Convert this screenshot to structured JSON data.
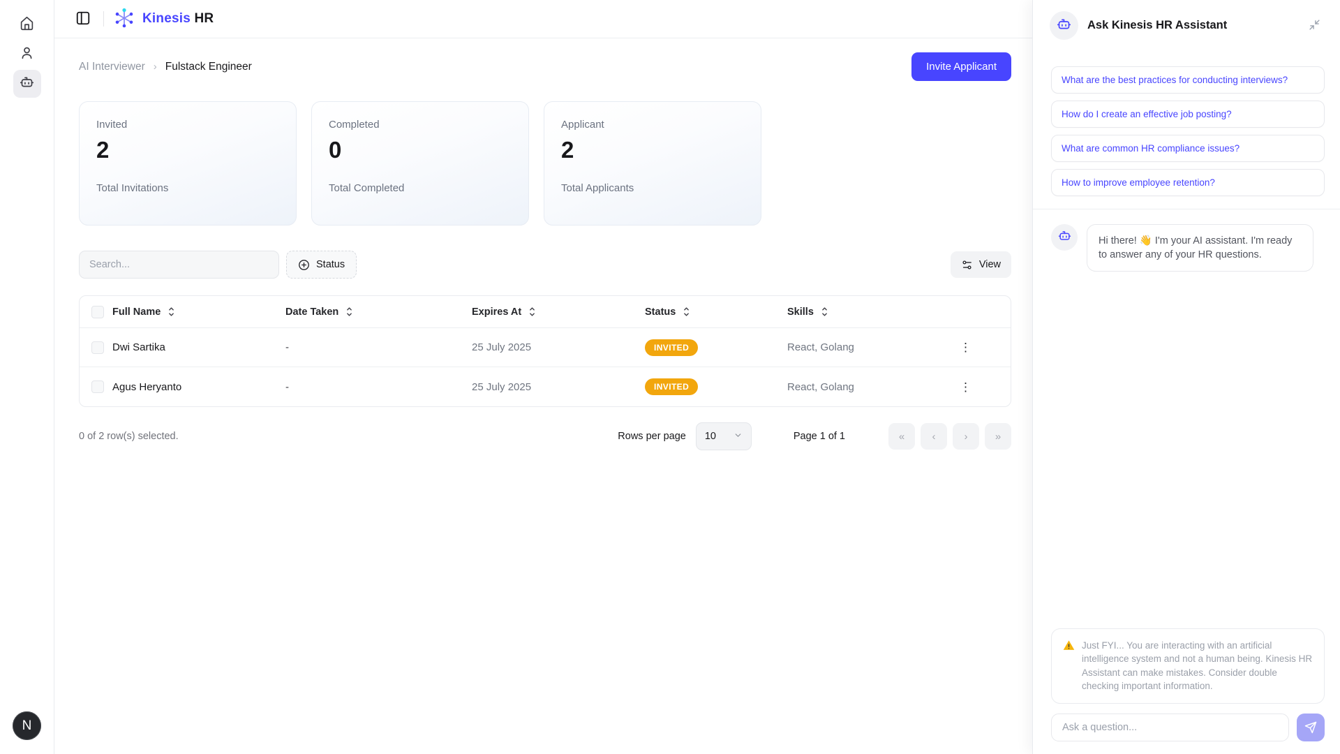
{
  "colors": {
    "brand": "#4845ff",
    "badge": "#f2a60d",
    "logo_accent": "#2bd9ee"
  },
  "sidebar": {
    "items": [
      {
        "name": "home",
        "icon": "home-icon"
      },
      {
        "name": "users",
        "icon": "user-icon"
      },
      {
        "name": "ai-interviewer",
        "icon": "bot-icon",
        "active": true
      }
    ],
    "avatar_label": "N"
  },
  "topbar": {
    "brand_primary": "Kinesis",
    "brand_secondary": "HR"
  },
  "breadcrumb": {
    "parent": "AI Interviewer",
    "separator": "›",
    "current": "Fulstack Engineer"
  },
  "invite_button_label": "Invite Applicant",
  "stats": [
    {
      "label": "Invited",
      "value": "2",
      "sub": "Total Invitations"
    },
    {
      "label": "Completed",
      "value": "0",
      "sub": "Total Completed"
    },
    {
      "label": "Applicant",
      "value": "2",
      "sub": "Total Applicants"
    }
  ],
  "toolbar": {
    "search_placeholder": "Search...",
    "status_label": "Status",
    "view_label": "View"
  },
  "table": {
    "columns": {
      "full_name": "Full Name",
      "date_taken": "Date Taken",
      "expires_at": "Expires At",
      "status": "Status",
      "skills": "Skills"
    },
    "row_menu_glyph": "⋮",
    "rows": [
      {
        "full_name": "Dwi Sartika",
        "date_taken": "-",
        "expires_at": "25 July 2025",
        "status": "INVITED",
        "skills": "React, Golang"
      },
      {
        "full_name": "Agus Heryanto",
        "date_taken": "-",
        "expires_at": "25 July 2025",
        "status": "INVITED",
        "skills": "React, Golang"
      }
    ]
  },
  "pagination": {
    "selection_text": "0 of 2 row(s) selected.",
    "rows_per_page_label": "Rows per page",
    "rows_per_page_value": "10",
    "page_text": "Page 1 of 1",
    "first_glyph": "«",
    "prev_glyph": "‹",
    "next_glyph": "›",
    "last_glyph": "»"
  },
  "assistant": {
    "title": "Ask Kinesis HR Assistant",
    "suggestions": [
      "What are the best practices for conducting interviews?",
      "How do I create an effective job posting?",
      "What are common HR compliance issues?",
      "How to improve employee retention?"
    ],
    "message": "Hi there! 👋 I'm your AI assistant. I'm ready to answer any of your HR questions.",
    "disclaimer": "Just FYI... You are interacting with an artificial intelligence system and not a human being. Kinesis HR Assistant can make mistakes. Consider double checking important information.",
    "input_placeholder": "Ask a question..."
  }
}
